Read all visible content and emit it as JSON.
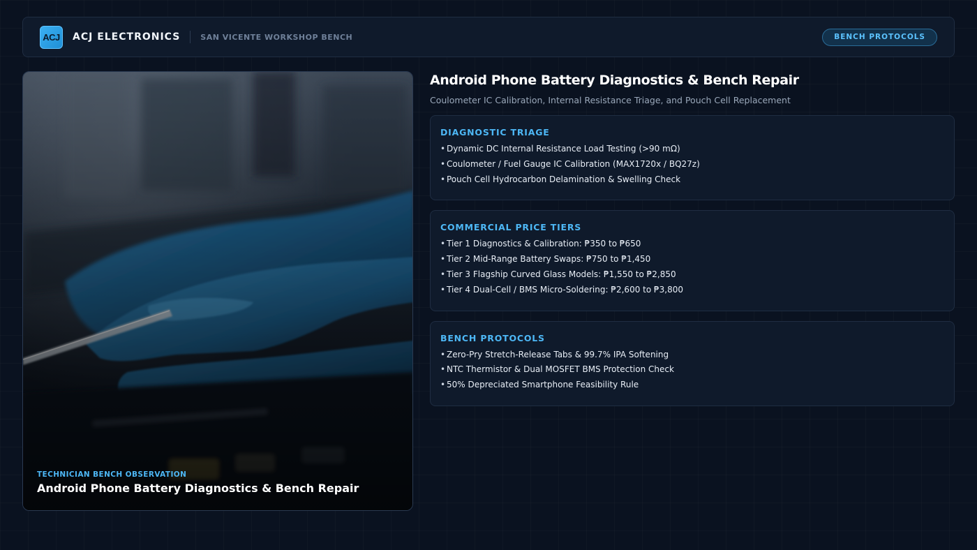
{
  "header": {
    "logo_text": "ACJ",
    "brand": "ACJ ELECTRONICS",
    "location": "SAN VICENTE WORKSHOP BENCH",
    "nav_button": "BENCH PROTOCOLS"
  },
  "photo": {
    "kicker": "TECHNICIAN BENCH OBSERVATION",
    "title": "Android Phone Battery Diagnostics & Bench Repair"
  },
  "main": {
    "title": "Android Phone Battery Diagnostics & Bench Repair",
    "subtitle": "Coulometer IC Calibration, Internal Resistance Triage, and Pouch Cell Replacement",
    "sections": [
      {
        "title": "DIAGNOSTIC TRIAGE",
        "items": [
          "Dynamic DC Internal Resistance Load Testing (>90 mΩ)",
          "Coulometer / Fuel Gauge IC Calibration (MAX1720x / BQ27z)",
          "Pouch Cell Hydrocarbon Delamination & Swelling Check"
        ]
      },
      {
        "title": "COMMERCIAL PRICE TIERS",
        "items": [
          "Tier 1 Diagnostics & Calibration: ₱350 to ₱650",
          "Tier 2 Mid-Range Battery Swaps: ₱750 to ₱1,450",
          "Tier 3 Flagship Curved Glass Models: ₱1,550 to ₱2,850",
          "Tier 4 Dual-Cell / BMS Micro-Soldering: ₱2,600 to ₱3,800"
        ]
      },
      {
        "title": "BENCH PROTOCOLS",
        "items": [
          "Zero-Pry Stretch-Release Tabs & 99.7% IPA Softening",
          "NTC Thermistor & Dual MOSFET BMS Protection Check",
          "50% Depreciated Smartphone Feasibility Rule"
        ]
      }
    ]
  },
  "colors": {
    "background": "#0a1220",
    "panel": "#0f1a2b",
    "accent": "#4db7f5"
  }
}
